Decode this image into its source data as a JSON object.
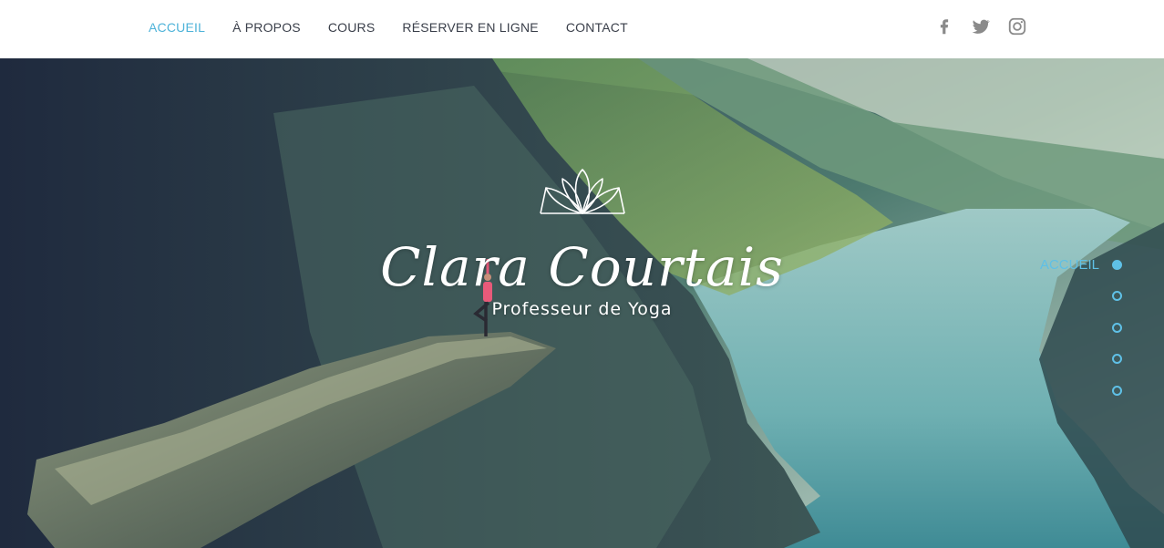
{
  "header": {
    "nav": [
      {
        "label": "ACCUEIL",
        "active": true
      },
      {
        "label": "À PROPOS",
        "active": false
      },
      {
        "label": "COURS",
        "active": false
      },
      {
        "label": "RÉSERVER EN LIGNE",
        "active": false
      },
      {
        "label": "CONTACT",
        "active": false
      }
    ],
    "social": [
      "facebook-icon",
      "twitter-icon",
      "instagram-icon"
    ]
  },
  "hero": {
    "title": "Clara Courtais",
    "subtitle": "Professeur de Yoga",
    "logo": "lotus-icon"
  },
  "dotnav": {
    "active_label": "ACCUEIL",
    "count": 5
  },
  "colors": {
    "accent": "#4eb3d9",
    "nav_text": "#3a3f4a",
    "social_icon": "#8a8a8a",
    "dot": "#5fc0e6"
  }
}
